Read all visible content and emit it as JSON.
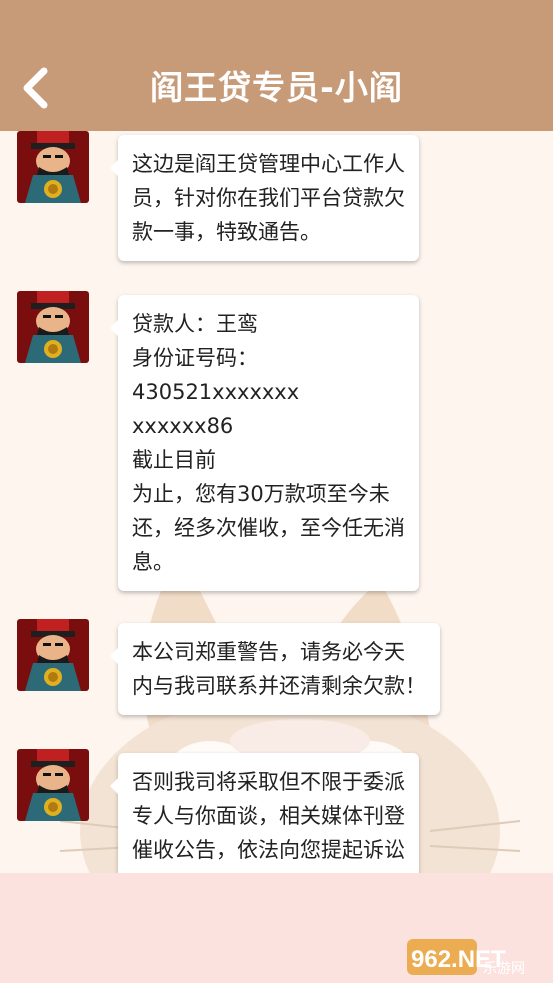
{
  "header": {
    "title": "阎王贷专员-小阎",
    "back_icon": "chevron-left-icon",
    "background": "#c79a78"
  },
  "messages": [
    {
      "avatar": "king-yama-avatar",
      "lines": [
        "这边是阎王贷管理中心工作人",
        "员，针对你在我们平台贷款欠",
        "款一事，特致通告。"
      ]
    },
    {
      "avatar": "king-yama-avatar",
      "lines": [
        "贷款人：王鸾",
        "身份证号码：",
        "430521xxxxxxx",
        "xxxxxx86",
        "截止目前",
        "为止，您有30万款项至今未",
        "还，经多次催收，至今任无消",
        "息。"
      ]
    },
    {
      "avatar": "king-yama-avatar",
      "lines": [
        "本公司郑重警告，请务必今天",
        "内与我司联系并还清剩余欠款！"
      ]
    },
    {
      "avatar": "king-yama-avatar",
      "lines": [
        "否则我司将采取但不限于委派",
        "专人与你面谈，相关媒体刊登",
        "催收公告，依法向您提起诉讼"
      ]
    }
  ],
  "watermark": {
    "text": "962.NET",
    "subtext": "乐游网"
  },
  "colors": {
    "chat_background": "#fdf5ee",
    "bottom_bar": "#fbe2df",
    "bubble": "#ffffff"
  }
}
